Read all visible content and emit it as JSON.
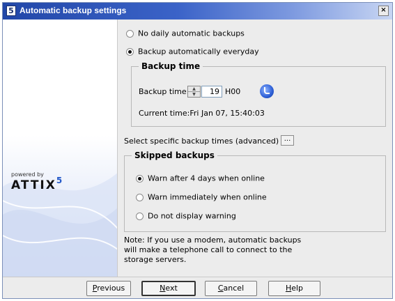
{
  "window": {
    "title": "Automatic backup settings",
    "app_icon_letter": "5",
    "close_label": "×"
  },
  "brand": {
    "powered_by": "powered by",
    "logo_text": "ATTIX",
    "logo_sup": "5"
  },
  "frequency": {
    "options": [
      {
        "label": "No daily automatic backups",
        "checked": false
      },
      {
        "label": "Backup automatically everyday",
        "checked": true
      }
    ]
  },
  "backup_time": {
    "group_title": "Backup time",
    "label": "Backup time:",
    "value": "19",
    "unit": "H00",
    "current_time": "Current time:Fri Jan 07, 15:40:03"
  },
  "advanced": {
    "label": "Select specific backup times (advanced)",
    "button_label": "..."
  },
  "skipped": {
    "group_title": "Skipped backups",
    "options": [
      {
        "label": "Warn after 4 days when online",
        "checked": true
      },
      {
        "label": "Warn immediately when online",
        "checked": false
      },
      {
        "label": "Do not display warning",
        "checked": false
      }
    ]
  },
  "note": {
    "line1": "Note: If you use a modem, automatic backups",
    "line2": "will make a telephone call to connect to the",
    "line3": "storage servers."
  },
  "buttons": {
    "previous": {
      "first": "P",
      "rest": "revious"
    },
    "next": {
      "first": "N",
      "rest": "ext"
    },
    "cancel": {
      "first": "C",
      "rest": "ancel"
    },
    "help": {
      "first": "H",
      "rest": "elp"
    }
  }
}
